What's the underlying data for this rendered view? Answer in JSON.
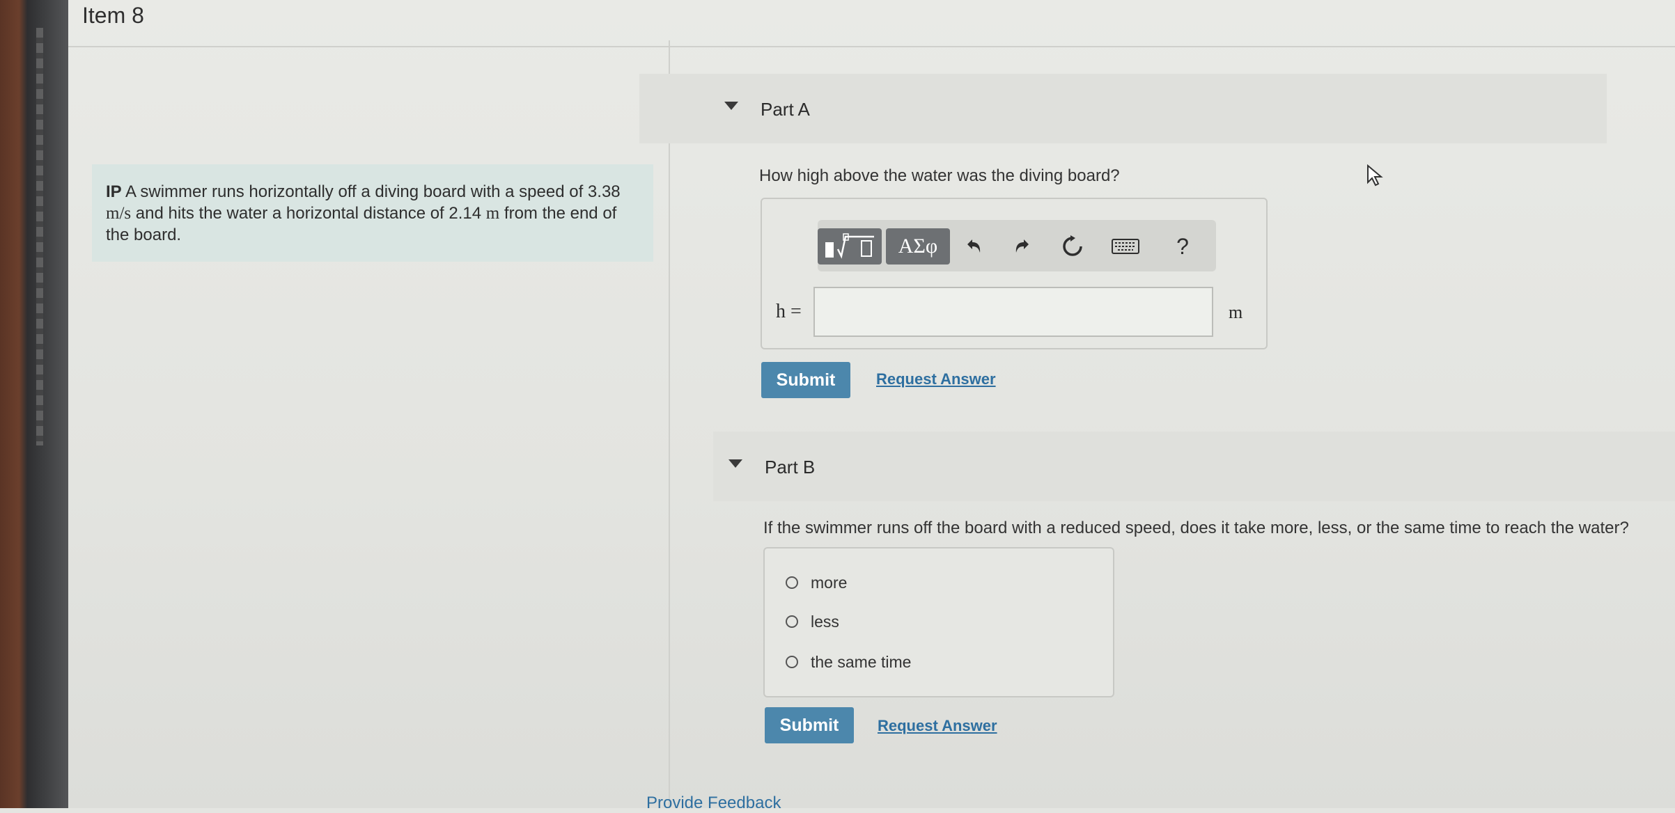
{
  "item": {
    "title": "Item 8"
  },
  "problem": {
    "prefix": "IP",
    "text_1": " A swimmer runs horizontally off a diving board with a speed of 3.38 ",
    "unit_speed": "m/s",
    "text_2": " and hits the water a horizontal distance of 2.14 ",
    "unit_distance": "m",
    "text_3": " from the end of the board."
  },
  "part_a": {
    "label": "Part A",
    "question": "How high above the water was the diving board?",
    "toolbar": {
      "templates_icon": "sqrt-template-icon",
      "greek_label": "ΑΣφ",
      "undo_icon": "undo-icon",
      "redo_icon": "redo-icon",
      "reset_icon": "reset-icon",
      "keyboard_icon": "keyboard-icon",
      "help_label": "?"
    },
    "variable_label": "h =",
    "answer_value": "",
    "unit": "m",
    "submit_label": "Submit",
    "request_answer_label": "Request Answer"
  },
  "part_b": {
    "label": "Part B",
    "question": "If the swimmer runs off the board with a reduced speed, does it take more, less, or the same time to reach the water?",
    "choices": [
      {
        "label": "more"
      },
      {
        "label": "less"
      },
      {
        "label": "the same time"
      }
    ],
    "submit_label": "Submit",
    "request_answer_label": "Request Answer"
  },
  "footer": {
    "feedback_label": "Provide Feedback"
  },
  "colors": {
    "submit": "#4c87ac",
    "link": "#2e6fa0",
    "toolbar_button": "#6d7073"
  }
}
